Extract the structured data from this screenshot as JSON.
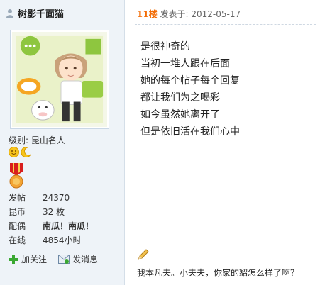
{
  "user": {
    "name": "树影千面猫",
    "rank_label": "级别: 昆山名人"
  },
  "stats": [
    {
      "label": "发帖",
      "value": "24370",
      "bold": false
    },
    {
      "label": "昆币",
      "value": "32 枚",
      "bold": false
    },
    {
      "label": "配偶",
      "value": "南瓜！南瓜！",
      "bold": true
    },
    {
      "label": "在线",
      "value": "4854小时",
      "bold": false
    }
  ],
  "actions": {
    "follow": "加关注",
    "message": "发消息"
  },
  "post": {
    "floor": "11楼",
    "posted_label": " 发表于: 2012-05-17",
    "lines": [
      "是很神奇的",
      "当初一堆人跟在后面",
      "她的每个帖子每个回复",
      "都让我们为之喝彩",
      "如今虽然她离开了",
      "但是依旧活在我们心中"
    ]
  },
  "signature": "我本凡夫。小夫夫，你家的貂怎么样了啊？",
  "colors": {
    "sidebar_bg": "#eef3f8",
    "floor": "#f26c06",
    "border": "#d4dee8"
  },
  "icons": [
    "user-icon",
    "smile-icon",
    "moon-icon",
    "medal-icon",
    "plus-icon",
    "mail-icon",
    "pencil-icon"
  ]
}
